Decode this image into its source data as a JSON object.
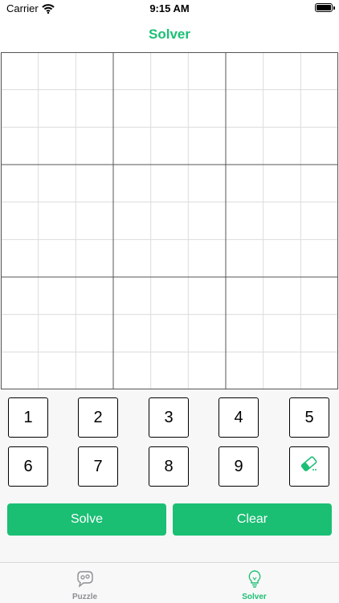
{
  "status_bar": {
    "carrier": "Carrier",
    "time": "9:15 AM"
  },
  "nav": {
    "title": "Solver"
  },
  "board": {
    "cells": [
      "",
      "",
      "",
      "",
      "",
      "",
      "",
      "",
      "",
      "",
      "",
      "",
      "",
      "",
      "",
      "",
      "",
      "",
      "",
      "",
      "",
      "",
      "",
      "",
      "",
      "",
      "",
      "",
      "",
      "",
      "",
      "",
      "",
      "",
      "",
      "",
      "",
      "",
      "",
      "",
      "",
      "",
      "",
      "",
      "",
      "",
      "",
      "",
      "",
      "",
      "",
      "",
      "",
      "",
      "",
      "",
      "",
      "",
      "",
      "",
      "",
      "",
      "",
      "",
      "",
      "",
      "",
      "",
      "",
      "",
      "",
      "",
      "",
      "",
      "",
      "",
      "",
      "",
      "",
      "",
      "",
      "",
      ""
    ]
  },
  "keypad": {
    "keys": [
      "1",
      "2",
      "3",
      "4",
      "5",
      "6",
      "7",
      "8",
      "9"
    ],
    "eraser_icon": "eraser-icon"
  },
  "actions": {
    "solve": "Solve",
    "clear": "Clear"
  },
  "tabs": [
    {
      "label": "Puzzle",
      "icon": "puzzle-icon",
      "selected": false
    },
    {
      "label": "Solver",
      "icon": "lightbulb-icon",
      "selected": true
    }
  ],
  "colors": {
    "accent": "#1bbf74",
    "inactive": "#8e8e93"
  }
}
